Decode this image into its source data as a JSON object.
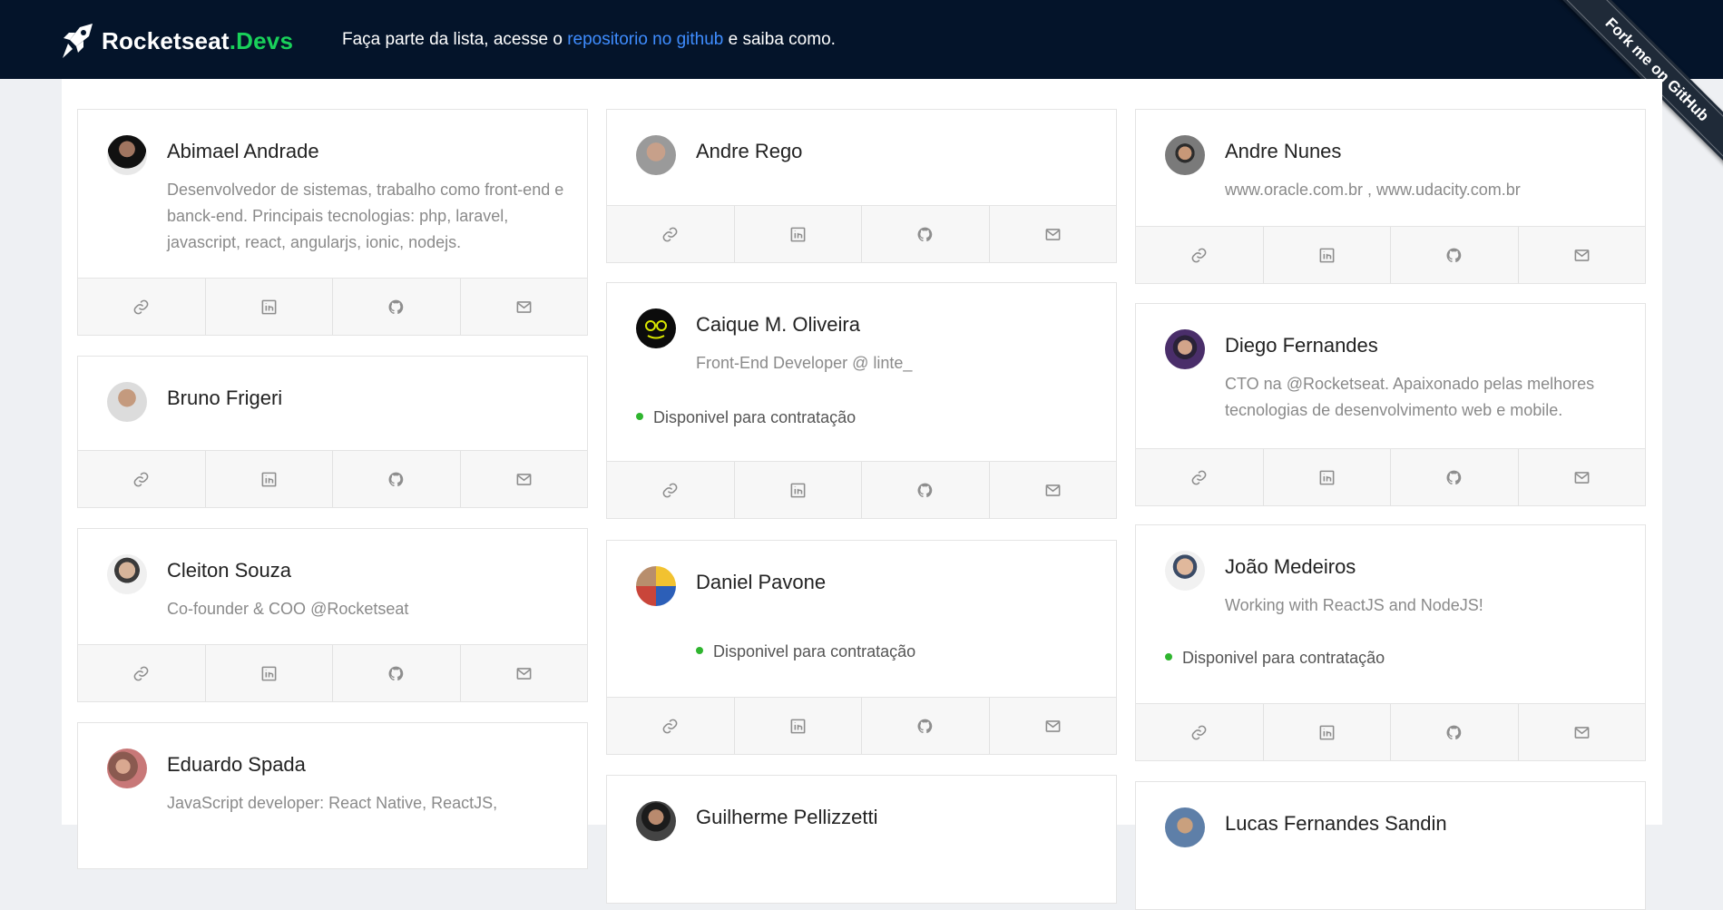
{
  "header": {
    "brand_main": "Rocketseat",
    "brand_accent": ".Devs",
    "banner_before": "Faça parte da lista, acesse o ",
    "banner_link": "repositorio no github",
    "banner_after": " e saiba como.",
    "ribbon": "Fork me on GitHub"
  },
  "colors": {
    "header_bg": "#04142a",
    "brand_accent": "#19d15a",
    "link": "#3f8dff",
    "available_dot": "#2fb52f"
  },
  "social_icons": [
    "link-icon",
    "linkedin-icon",
    "github-icon",
    "mail-icon"
  ],
  "columns": [
    {
      "cards": [
        {
          "name": "Abimael Andrade",
          "bio": "Desenvolvedor de sistemas, trabalho como front-end e banck-end. Principais tecnologias: php, laravel, javascript, react, angularjs, ionic, nodejs."
        },
        {
          "name": "Bruno Frigeri"
        },
        {
          "name": "Cleiton Souza",
          "bio": "Co-founder & COO @Rocketseat"
        },
        {
          "name": "Eduardo Spada",
          "bio": "JavaScript developer: React Native, ReactJS,"
        }
      ]
    },
    {
      "cards": [
        {
          "name": "Andre Rego"
        },
        {
          "name": "Caique M. Oliveira",
          "bio": "Front-End Developer @ linte_",
          "available": "Disponivel para contratação"
        },
        {
          "name": "Daniel Pavone",
          "available": "Disponivel para contratação"
        },
        {
          "name": "Guilherme Pellizzetti"
        }
      ]
    },
    {
      "cards": [
        {
          "name": "Andre Nunes",
          "bio": "www.oracle.com.br , www.udacity.com.br"
        },
        {
          "name": "Diego Fernandes",
          "bio": "CTO na @Rocketseat. Apaixonado pelas melhores tecnologias de desenvolvimento web e mobile."
        },
        {
          "name": "João Medeiros",
          "bio": "Working with ReactJS and NodeJS!",
          "available": "Disponivel para contratação"
        },
        {
          "name": "Lucas Fernandes Sandin"
        }
      ]
    }
  ]
}
